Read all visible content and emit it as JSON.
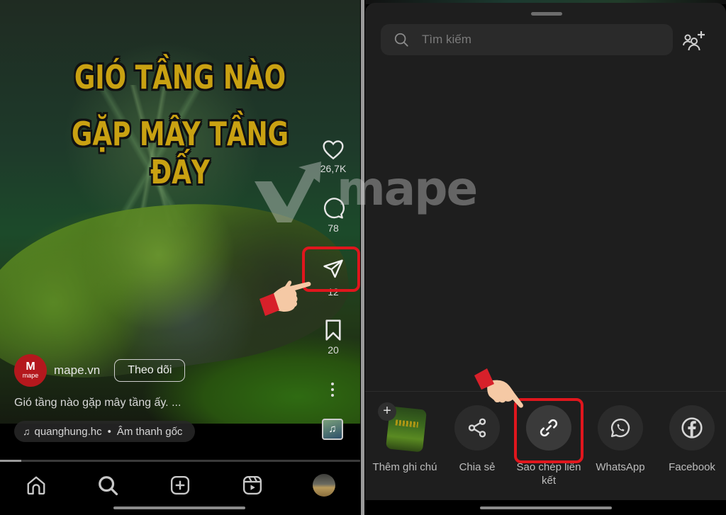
{
  "left_screen": {
    "video": {
      "headline_line1": "GIÓ TẦNG NÀO",
      "headline_line2": "GẶP MÂY TẦNG ĐẤY",
      "progress_fraction": 0.06
    },
    "actions": {
      "like_count": "26,7K",
      "comment_count": "78",
      "share_count": "12",
      "save_count": "20"
    },
    "author": {
      "avatar_brand": "mape",
      "name": "mape.vn",
      "follow_label": "Theo dõi"
    },
    "caption": "Gió tầng nào gặp mây tầng ấy. ...",
    "audio": {
      "creator": "quanghung.hc",
      "separator": "•",
      "title": "Âm thanh gốc"
    },
    "bottom_nav": [
      "home",
      "search",
      "create",
      "reels",
      "profile"
    ]
  },
  "right_screen": {
    "search": {
      "placeholder": "Tìm kiếm",
      "value": ""
    },
    "share_options": [
      {
        "label": "Thêm ghi chú",
        "icon": "add-note"
      },
      {
        "label": "Chia sẻ",
        "icon": "share"
      },
      {
        "label": "Sao chép liên kết",
        "icon": "link",
        "highlighted": true
      },
      {
        "label": "WhatsApp",
        "icon": "whatsapp"
      },
      {
        "label": "Facebook",
        "icon": "facebook"
      }
    ]
  },
  "watermark": "mape",
  "colors": {
    "highlight": "#e0161d",
    "headline": "#c9a112",
    "sheet_bg": "#1e1e1e",
    "brand_red": "#b4181d"
  }
}
